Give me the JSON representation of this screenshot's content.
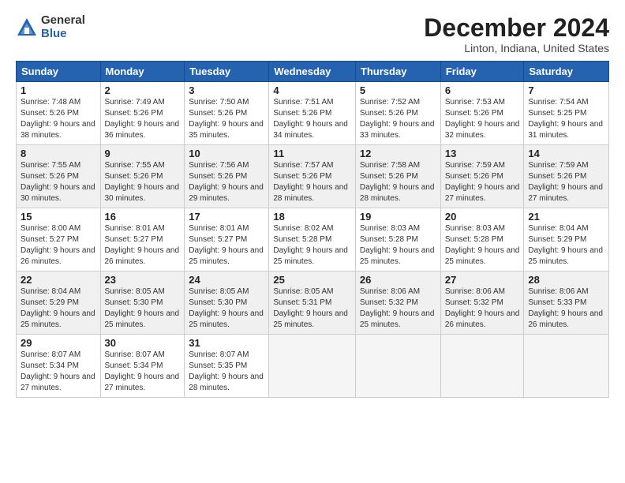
{
  "header": {
    "logo_general": "General",
    "logo_blue": "Blue",
    "month_title": "December 2024",
    "location": "Linton, Indiana, United States"
  },
  "days_of_week": [
    "Sunday",
    "Monday",
    "Tuesday",
    "Wednesday",
    "Thursday",
    "Friday",
    "Saturday"
  ],
  "weeks": [
    [
      {
        "num": "1",
        "sunrise": "7:48 AM",
        "sunset": "5:26 PM",
        "daylight": "9 hours and 38 minutes."
      },
      {
        "num": "2",
        "sunrise": "7:49 AM",
        "sunset": "5:26 PM",
        "daylight": "9 hours and 36 minutes."
      },
      {
        "num": "3",
        "sunrise": "7:50 AM",
        "sunset": "5:26 PM",
        "daylight": "9 hours and 35 minutes."
      },
      {
        "num": "4",
        "sunrise": "7:51 AM",
        "sunset": "5:26 PM",
        "daylight": "9 hours and 34 minutes."
      },
      {
        "num": "5",
        "sunrise": "7:52 AM",
        "sunset": "5:26 PM",
        "daylight": "9 hours and 33 minutes."
      },
      {
        "num": "6",
        "sunrise": "7:53 AM",
        "sunset": "5:26 PM",
        "daylight": "9 hours and 32 minutes."
      },
      {
        "num": "7",
        "sunrise": "7:54 AM",
        "sunset": "5:25 PM",
        "daylight": "9 hours and 31 minutes."
      }
    ],
    [
      {
        "num": "8",
        "sunrise": "7:55 AM",
        "sunset": "5:26 PM",
        "daylight": "9 hours and 30 minutes."
      },
      {
        "num": "9",
        "sunrise": "7:55 AM",
        "sunset": "5:26 PM",
        "daylight": "9 hours and 30 minutes."
      },
      {
        "num": "10",
        "sunrise": "7:56 AM",
        "sunset": "5:26 PM",
        "daylight": "9 hours and 29 minutes."
      },
      {
        "num": "11",
        "sunrise": "7:57 AM",
        "sunset": "5:26 PM",
        "daylight": "9 hours and 28 minutes."
      },
      {
        "num": "12",
        "sunrise": "7:58 AM",
        "sunset": "5:26 PM",
        "daylight": "9 hours and 28 minutes."
      },
      {
        "num": "13",
        "sunrise": "7:59 AM",
        "sunset": "5:26 PM",
        "daylight": "9 hours and 27 minutes."
      },
      {
        "num": "14",
        "sunrise": "7:59 AM",
        "sunset": "5:26 PM",
        "daylight": "9 hours and 27 minutes."
      }
    ],
    [
      {
        "num": "15",
        "sunrise": "8:00 AM",
        "sunset": "5:27 PM",
        "daylight": "9 hours and 26 minutes."
      },
      {
        "num": "16",
        "sunrise": "8:01 AM",
        "sunset": "5:27 PM",
        "daylight": "9 hours and 26 minutes."
      },
      {
        "num": "17",
        "sunrise": "8:01 AM",
        "sunset": "5:27 PM",
        "daylight": "9 hours and 25 minutes."
      },
      {
        "num": "18",
        "sunrise": "8:02 AM",
        "sunset": "5:28 PM",
        "daylight": "9 hours and 25 minutes."
      },
      {
        "num": "19",
        "sunrise": "8:03 AM",
        "sunset": "5:28 PM",
        "daylight": "9 hours and 25 minutes."
      },
      {
        "num": "20",
        "sunrise": "8:03 AM",
        "sunset": "5:28 PM",
        "daylight": "9 hours and 25 minutes."
      },
      {
        "num": "21",
        "sunrise": "8:04 AM",
        "sunset": "5:29 PM",
        "daylight": "9 hours and 25 minutes."
      }
    ],
    [
      {
        "num": "22",
        "sunrise": "8:04 AM",
        "sunset": "5:29 PM",
        "daylight": "9 hours and 25 minutes."
      },
      {
        "num": "23",
        "sunrise": "8:05 AM",
        "sunset": "5:30 PM",
        "daylight": "9 hours and 25 minutes."
      },
      {
        "num": "24",
        "sunrise": "8:05 AM",
        "sunset": "5:30 PM",
        "daylight": "9 hours and 25 minutes."
      },
      {
        "num": "25",
        "sunrise": "8:05 AM",
        "sunset": "5:31 PM",
        "daylight": "9 hours and 25 minutes."
      },
      {
        "num": "26",
        "sunrise": "8:06 AM",
        "sunset": "5:32 PM",
        "daylight": "9 hours and 25 minutes."
      },
      {
        "num": "27",
        "sunrise": "8:06 AM",
        "sunset": "5:32 PM",
        "daylight": "9 hours and 26 minutes."
      },
      {
        "num": "28",
        "sunrise": "8:06 AM",
        "sunset": "5:33 PM",
        "daylight": "9 hours and 26 minutes."
      }
    ],
    [
      {
        "num": "29",
        "sunrise": "8:07 AM",
        "sunset": "5:34 PM",
        "daylight": "9 hours and 27 minutes."
      },
      {
        "num": "30",
        "sunrise": "8:07 AM",
        "sunset": "5:34 PM",
        "daylight": "9 hours and 27 minutes."
      },
      {
        "num": "31",
        "sunrise": "8:07 AM",
        "sunset": "5:35 PM",
        "daylight": "9 hours and 28 minutes."
      },
      null,
      null,
      null,
      null
    ]
  ],
  "labels": {
    "sunrise": "Sunrise:",
    "sunset": "Sunset:",
    "daylight": "Daylight:"
  }
}
